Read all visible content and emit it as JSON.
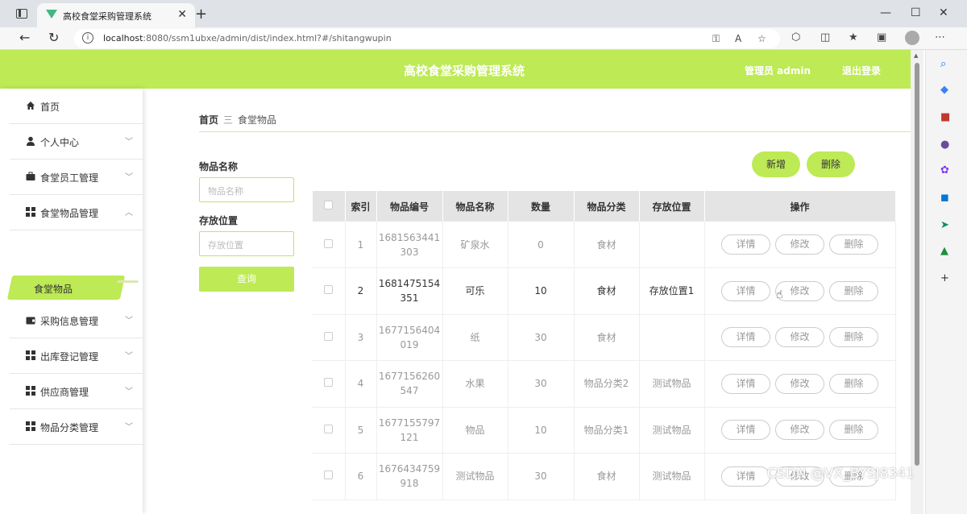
{
  "browser": {
    "tab_title": "高校食堂采购管理系统",
    "url_host": "localhost",
    "url_rest": ":8080/ssm1ubxe/admin/dist/index.html?#/shitangwupin",
    "new_tab": "+",
    "close": "✕"
  },
  "header": {
    "title": "高校食堂采购管理系统",
    "admin": "管理员 admin",
    "logout": "退出登录"
  },
  "sidebar": {
    "items": [
      {
        "label": "首页",
        "icon": "home-icon",
        "arrow": ""
      },
      {
        "label": "个人中心",
        "icon": "user-icon",
        "arrow": "﹀"
      },
      {
        "label": "食堂员工管理",
        "icon": "briefcase-icon",
        "arrow": "﹀"
      },
      {
        "label": "食堂物品管理",
        "icon": "grid-icon",
        "arrow": "︿"
      },
      {
        "label": "采购信息管理",
        "icon": "wallet-icon",
        "arrow": "﹀"
      },
      {
        "label": "出库登记管理",
        "icon": "grid-icon",
        "arrow": "﹀"
      },
      {
        "label": "供应商管理",
        "icon": "grid-icon",
        "arrow": "﹀"
      },
      {
        "label": "物品分类管理",
        "icon": "grid-icon",
        "arrow": "﹀"
      }
    ],
    "active_sub": "食堂物品"
  },
  "breadcrumb": {
    "home": "首页",
    "sep": "三",
    "current": "食堂物品"
  },
  "search": {
    "name_label": "物品名称",
    "name_placeholder": "物品名称",
    "location_label": "存放位置",
    "location_placeholder": "存放位置",
    "query_button": "查询"
  },
  "actions": {
    "add": "新增",
    "delete": "删除"
  },
  "table": {
    "headers": [
      "",
      "索引",
      "物品编号",
      "物品名称",
      "数量",
      "物品分类",
      "存放位置",
      "操作"
    ],
    "rows": [
      {
        "index": "1",
        "code_a": "1681563441",
        "code_b": "303",
        "name": "矿泉水",
        "qty": "0",
        "category": "食材",
        "location": ""
      },
      {
        "index": "2",
        "code_a": "1681475154",
        "code_b": "351",
        "name": "可乐",
        "qty": "10",
        "category": "食材",
        "location": "存放位置1"
      },
      {
        "index": "3",
        "code_a": "1677156404",
        "code_b": "019",
        "name": "纸",
        "qty": "30",
        "category": "食材",
        "location": ""
      },
      {
        "index": "4",
        "code_a": "1677156260",
        "code_b": "547",
        "name": "水果",
        "qty": "30",
        "category": "物品分类2",
        "location": "测试物品"
      },
      {
        "index": "5",
        "code_a": "1677155797",
        "code_b": "121",
        "name": "物品",
        "qty": "10",
        "category": "物品分类1",
        "location": "测试物品"
      },
      {
        "index": "6",
        "code_a": "1676434759",
        "code_b": "918",
        "name": "测试物品",
        "qty": "30",
        "category": "食材",
        "location": "测试物品"
      }
    ],
    "op_detail": "详情",
    "op_edit": "修改",
    "op_delete": "删除"
  },
  "watermark": "CSDN @VX_BYSJ8341"
}
